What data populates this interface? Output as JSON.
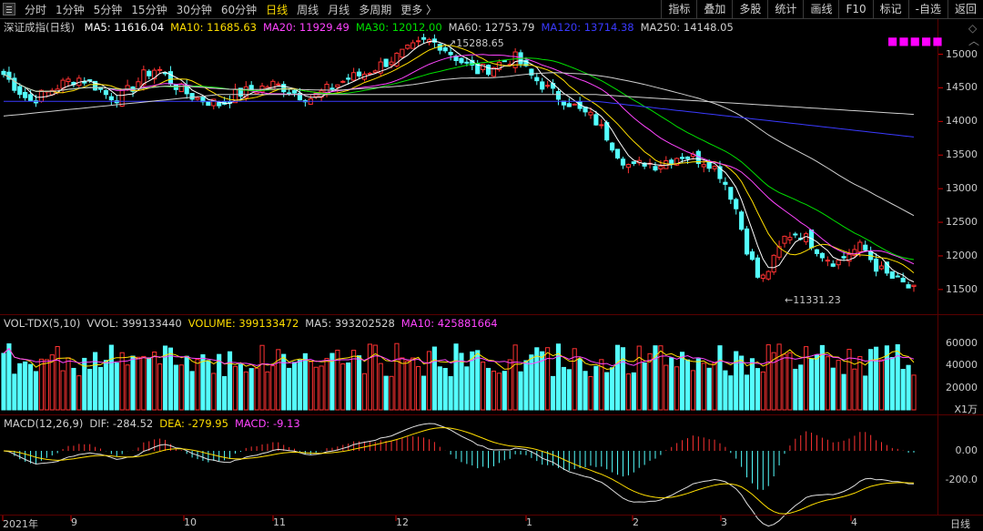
{
  "toolbar": {
    "periods": [
      "分时",
      "1分钟",
      "5分钟",
      "15分钟",
      "30分钟",
      "60分钟",
      "日线",
      "周线",
      "月线",
      "多周期",
      "更多 〉"
    ],
    "active_period": "日线",
    "tools": [
      "指标",
      "叠加",
      "多股",
      "统计",
      "画线",
      "F10",
      "标记",
      "-自选",
      "返回"
    ]
  },
  "main": {
    "name": "深证成指(日线)",
    "ma": [
      {
        "label": "MA5: 11616.04",
        "color": "#ffffff"
      },
      {
        "label": "MA10: 11685.63",
        "color": "#ffde00"
      },
      {
        "label": "MA20: 11929.49",
        "color": "#ff44ff"
      },
      {
        "label": "MA30: 12012.00",
        "color": "#00e000"
      },
      {
        "label": "MA60: 12753.79",
        "color": "#d0d0d0"
      },
      {
        "label": "MA120: 13714.38",
        "color": "#3a3aff"
      },
      {
        "label": "MA250: 14148.05",
        "color": "#d0d0d0"
      }
    ],
    "y_ticks": [
      "15000",
      "14500",
      "14000",
      "13500",
      "13000",
      "12500",
      "12000",
      "11500"
    ],
    "high_label": "15288.65",
    "low_label": "11331.23"
  },
  "vol": {
    "legend": [
      {
        "label": "VOL-TDX(5,10)",
        "color": "#d0d0d0"
      },
      {
        "label": "VVOL: 399133440",
        "color": "#d0d0d0"
      },
      {
        "label": "VOLUME: 399133472",
        "color": "#ffde00"
      },
      {
        "label": "MA5: 393202528",
        "color": "#d0d0d0"
      },
      {
        "label": "MA10: 425881664",
        "color": "#ff44ff"
      }
    ],
    "y_ticks": [
      "60000",
      "40000",
      "20000"
    ],
    "unit": "X1万"
  },
  "macd": {
    "legend": [
      {
        "label": "MACD(12,26,9)",
        "color": "#d0d0d0"
      },
      {
        "label": "DIF: -284.52",
        "color": "#d0d0d0"
      },
      {
        "label": "DEA: -279.95",
        "color": "#ffde00"
      },
      {
        "label": "MACD: -9.13",
        "color": "#ff44ff"
      }
    ],
    "y_ticks": [
      "0.00",
      "-200.0"
    ]
  },
  "x_axis": {
    "labels": [
      "2021年",
      "9",
      "10",
      "11",
      "12",
      "1",
      "2",
      "3",
      "4"
    ],
    "period": "日线"
  },
  "colors": {
    "up": "#ff3232",
    "down": "#54ffff",
    "grid": "#5a0000"
  },
  "chart_data": {
    "type": "candlestick",
    "title": "深证成指(日线)",
    "series_main_close_approx": [
      14700,
      14500,
      14300,
      14400,
      14500,
      14600,
      14650,
      14550,
      14400,
      14350,
      14500,
      14700,
      14800,
      14600,
      14450,
      14350,
      14300,
      14250,
      14400,
      14450,
      14500,
      14550,
      14500,
      14400,
      14350,
      14450,
      14550,
      14650,
      14700,
      14800,
      14900,
      15000,
      15100,
      15200,
      15150,
      15000,
      14850,
      14750,
      14800,
      14900,
      14950,
      14700,
      14550,
      14400,
      14300,
      14150,
      14050,
      13800,
      13500,
      13300,
      13400,
      13350,
      13450,
      13500,
      13450,
      13400,
      13200,
      12800,
      12100,
      11600,
      11900,
      12300,
      12350,
      12200,
      12000,
      11900,
      12050,
      12150,
      11850,
      11700,
      11600,
      11480
    ],
    "ylim": [
      11200,
      15400
    ],
    "high_marker": 15288.65,
    "low_marker": 11331.23
  }
}
